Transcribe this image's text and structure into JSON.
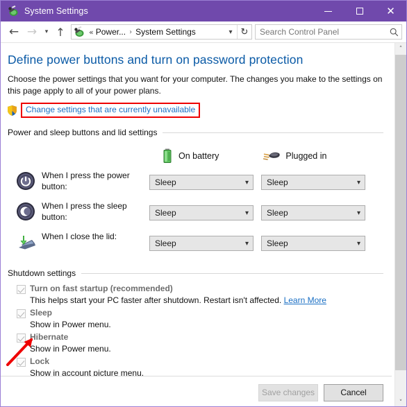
{
  "window": {
    "title": "System Settings",
    "icon": "power-options-icon",
    "controls": {
      "minimize": "minimize-icon",
      "maximize": "maximize-icon",
      "close": "close-icon"
    }
  },
  "navbar": {
    "back": "back-arrow-icon",
    "forward": "forward-arrow-icon",
    "recent": "recent-locations-chevron-icon",
    "up": "up-arrow-icon",
    "address": {
      "icon": "power-options-icon",
      "overflow": "«",
      "crumbs": [
        "Power...",
        "System Settings"
      ],
      "separator": "›",
      "dropdown": "chevron-down-icon",
      "refresh": "refresh-icon"
    },
    "search": {
      "placeholder": "Search Control Panel",
      "value": "",
      "icon": "search-icon"
    }
  },
  "page": {
    "title": "Define power buttons and turn on password protection",
    "description": "Choose the power settings that you want for your computer. The changes you make to the settings on this page apply to all of your power plans.",
    "uac": {
      "shield_icon": "uac-shield-icon",
      "link_text": "Change settings that are currently unavailable",
      "highlight_color": "#ee0000"
    },
    "sections": {
      "power_buttons": {
        "heading": "Power and sleep buttons and lid settings",
        "columns": [
          {
            "label": "On battery",
            "icon": "battery-icon"
          },
          {
            "label": "Plugged in",
            "icon": "power-plug-icon"
          }
        ],
        "rows": [
          {
            "icon": "power-button-icon",
            "label": "When I press the power button:",
            "on_battery": "Sleep",
            "plugged_in": "Sleep"
          },
          {
            "icon": "sleep-button-icon",
            "label": "When I press the sleep button:",
            "on_battery": "Sleep",
            "plugged_in": "Sleep"
          },
          {
            "icon": "laptop-lid-icon",
            "label": "When I close the lid:",
            "on_battery": "Sleep",
            "plugged_in": "Sleep"
          }
        ]
      },
      "shutdown": {
        "heading": "Shutdown settings",
        "items": [
          {
            "label": "Turn on fast startup (recommended)",
            "checked": true,
            "enabled": false,
            "description": "This helps start your PC faster after shutdown. Restart isn't affected.",
            "link": "Learn More"
          },
          {
            "label": "Sleep",
            "checked": true,
            "enabled": false,
            "description": "Show in Power menu.",
            "link": ""
          },
          {
            "label": "Hibernate",
            "checked": true,
            "enabled": false,
            "description": "Show in Power menu.",
            "link": ""
          },
          {
            "label": "Lock",
            "checked": true,
            "enabled": false,
            "description": "Show in account picture menu.",
            "link": ""
          }
        ]
      }
    }
  },
  "footer": {
    "save_label": "Save changes",
    "save_enabled": false,
    "cancel_label": "Cancel",
    "cancel_enabled": true
  },
  "scrollbar": {
    "up_glyph": "˄",
    "down_glyph": "˅"
  },
  "annotations": {
    "arrow_color": "#ee0000",
    "arrow_target": "turn-on-fast-startup-checkbox"
  },
  "theme": {
    "titlebar_bg": "#7049ac",
    "link_color": "#1a6fc4",
    "title_color": "#0a5aa6"
  }
}
